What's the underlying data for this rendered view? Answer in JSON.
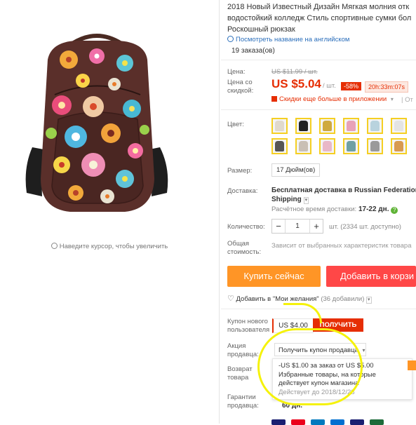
{
  "product": {
    "title_lines": [
      "2018 Новый Известный Дизайн Мягкая молния отк",
      "водостойкий колледж Стиль спортивные сумки бол",
      "Роскошный рюкзак"
    ],
    "translate_link": "Посмотреть название на английском",
    "orders": "19 заказа(ов)",
    "zoom_hint": "Наведите курсор, чтобы увеличить"
  },
  "price": {
    "label": "Цена:",
    "old_price": "US $11.99 / шт.",
    "discount_label": "Цена со скидкой:",
    "discount_price": "US $5.04",
    "unit": "/ шт.",
    "badge": "-58%",
    "timer": "20h:33m:07s",
    "app_promo": "Скидки еще больше в приложении",
    "more": "От"
  },
  "color": {
    "label": "Цвет:",
    "swatches": [
      "#d9a441",
      "#2b2b2b",
      "#d6b347",
      "#e8a2b8",
      "#9bc4d6",
      "#e8e8e8",
      "#d7a77a",
      "#7a7a7a",
      "#c9c0b5",
      "#e9b8c8",
      "#6fa0a5",
      "#9a9a9a",
      "#d89a50"
    ]
  },
  "size": {
    "label": "Размер:",
    "value": "17 Дюйм(ов)"
  },
  "shipping": {
    "label": "Доставка:",
    "text": "Бесплатная доставка в Russian Federation слу",
    "method": "Shipping",
    "eta_label": "Расчётное время доставки:",
    "eta_value": "17-22 дн."
  },
  "quantity": {
    "label": "Количество:",
    "value": "1",
    "minus": "−",
    "plus": "+",
    "available": "шт. (2334 шт. доступно)"
  },
  "total": {
    "label": "Общая стоимость:",
    "text": "Зависит от выбранных характеристик товара"
  },
  "actions": {
    "buy_now": "Купить сейчас",
    "add_to_cart": "Добавить в корзи",
    "wishlist": "Добавить в \"Мои желания\"",
    "wishlist_count": "(36 добавили)"
  },
  "coupon": {
    "new_user_label": "Купон нового пользователя",
    "new_user_value": "US $4.00",
    "get_button": "ПОЛУЧИТЬ",
    "seller_label": "Акция продавца:",
    "seller_dropdown": "Получить купон продавца",
    "dropdown_lines": [
      "-US $1.00 за заказ от US $5.00",
      "Избранные товары, на которые",
      "действует купон магазина"
    ],
    "dropdown_valid": "Действует до 2018/12/28"
  },
  "returns": {
    "label": "Возврат товара"
  },
  "guarantee": {
    "label": "Гарантии продавца:",
    "value": "60 дн."
  },
  "payment_colors": [
    "#1a1f71",
    "#eb001b",
    "#0079be",
    "#016fd0",
    "#1a1f71",
    "#1d6b3a"
  ]
}
